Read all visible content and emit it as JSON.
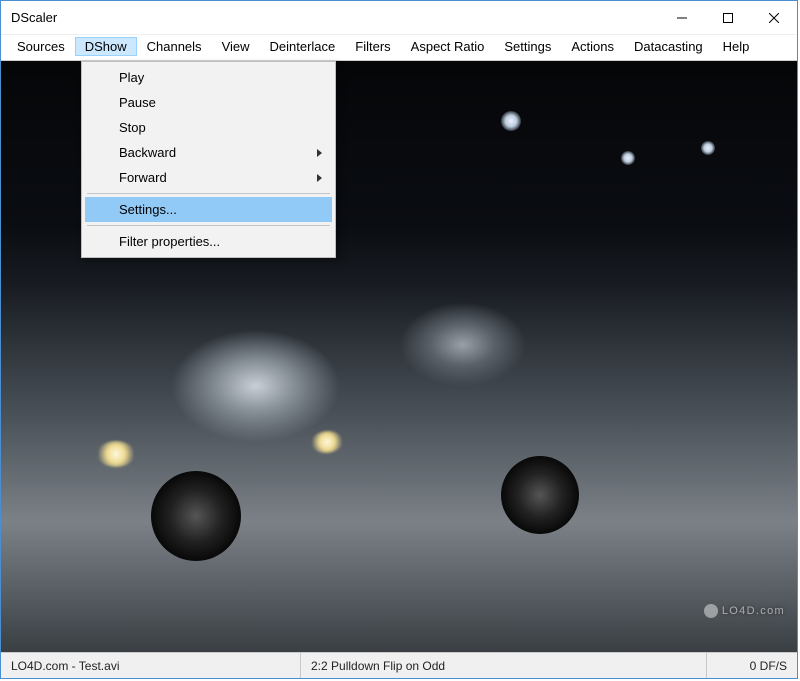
{
  "window": {
    "title": "DScaler"
  },
  "menubar": {
    "items": [
      {
        "label": "Sources"
      },
      {
        "label": "DShow"
      },
      {
        "label": "Channels"
      },
      {
        "label": "View"
      },
      {
        "label": "Deinterlace"
      },
      {
        "label": "Filters"
      },
      {
        "label": "Aspect Ratio"
      },
      {
        "label": "Settings"
      },
      {
        "label": "Actions"
      },
      {
        "label": "Datacasting"
      },
      {
        "label": "Help"
      }
    ],
    "active_index": 1
  },
  "dropdown": {
    "items": [
      {
        "label": "Play",
        "has_submenu": false
      },
      {
        "label": "Pause",
        "has_submenu": false
      },
      {
        "label": "Stop",
        "has_submenu": false
      },
      {
        "label": "Backward",
        "has_submenu": true
      },
      {
        "label": "Forward",
        "has_submenu": true
      }
    ],
    "highlighted": {
      "label": "Settings..."
    },
    "after_sep": {
      "label": "Filter properties..."
    }
  },
  "statusbar": {
    "file": "LO4D.com - Test.avi",
    "mode": "2:2 Pulldown Flip on Odd",
    "fps": "0 DF/S"
  },
  "watermark": "LO4D.com"
}
